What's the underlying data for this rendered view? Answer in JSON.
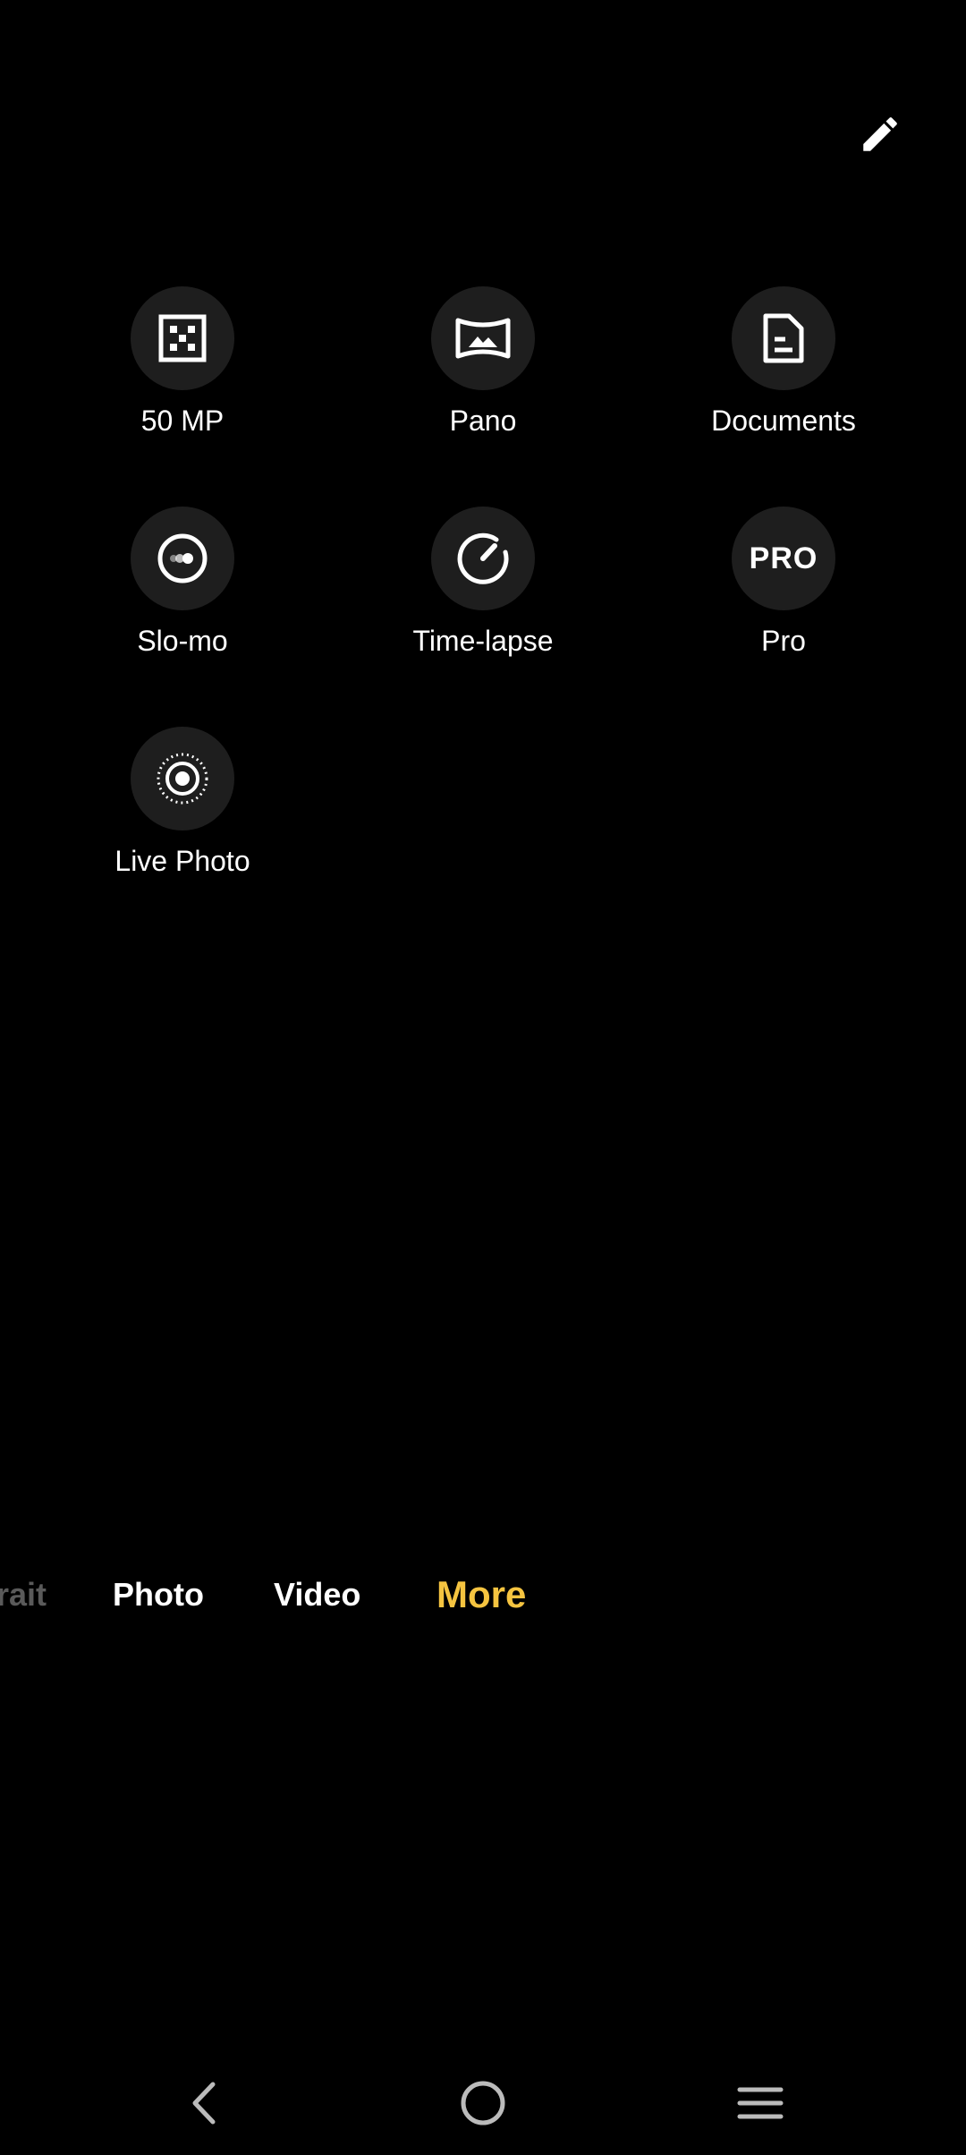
{
  "toolbar": {
    "edit_icon": "pencil-icon"
  },
  "modes": [
    {
      "label": "50 MP",
      "icon": "grid-dots-icon"
    },
    {
      "label": "Pano",
      "icon": "panorama-icon"
    },
    {
      "label": "Documents",
      "icon": "document-icon"
    },
    {
      "label": "Slo-mo",
      "icon": "slow-motion-icon"
    },
    {
      "label": "Time-lapse",
      "icon": "gauge-icon"
    },
    {
      "label": "Pro",
      "icon": "pro-badge-icon",
      "icon_text": "PRO"
    },
    {
      "label": "Live Photo",
      "icon": "live-photo-icon"
    }
  ],
  "mode_tabs": [
    {
      "label": "rait",
      "state": "partial"
    },
    {
      "label": "Photo",
      "state": "normal"
    },
    {
      "label": "Video",
      "state": "normal"
    },
    {
      "label": "More",
      "state": "active"
    }
  ],
  "colors": {
    "background": "#000000",
    "circle": "#1e1e1e",
    "active_tab": "#f5c440",
    "faded_tab": "#5a5a5a",
    "text": "#ffffff"
  },
  "nav": {
    "back_icon": "back-chevron-icon",
    "home_icon": "home-circle-icon",
    "menu_icon": "menu-lines-icon"
  }
}
